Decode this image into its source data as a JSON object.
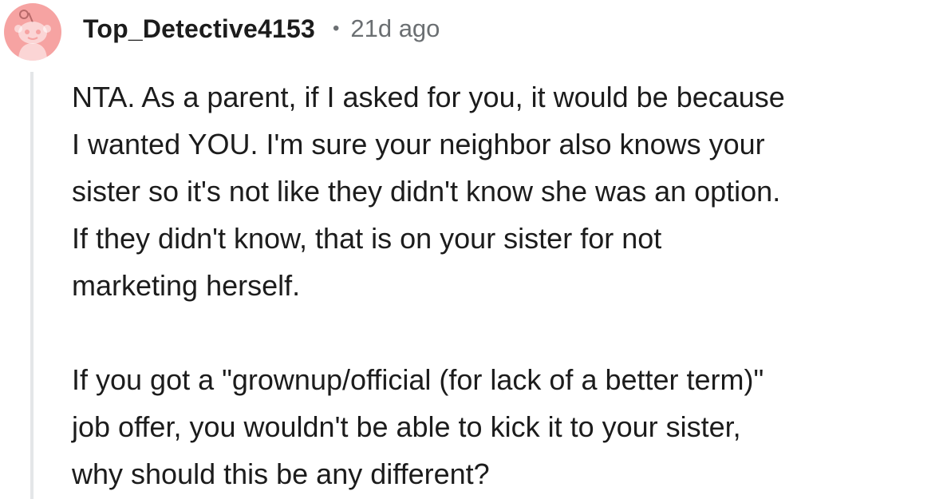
{
  "comment": {
    "username": "Top_Detective4153",
    "separator": "•",
    "age": "21d ago",
    "avatar_icon": "snoo-avatar-icon",
    "avatar_color": "#f6a3a2",
    "paragraphs": [
      "NTA. As a parent, if I asked for you, it would be because\nI wanted YOU. I'm sure your neighbor also knows your\nsister so it's not like they didn't know she was an option.\nIf they didn't know, that is on your sister for not\nmarketing herself.",
      "If you got a \"grownup/official (for lack of a better term)\"\njob offer, you wouldn't be able to kick it to your sister,\nwhy should this be any different?"
    ]
  }
}
